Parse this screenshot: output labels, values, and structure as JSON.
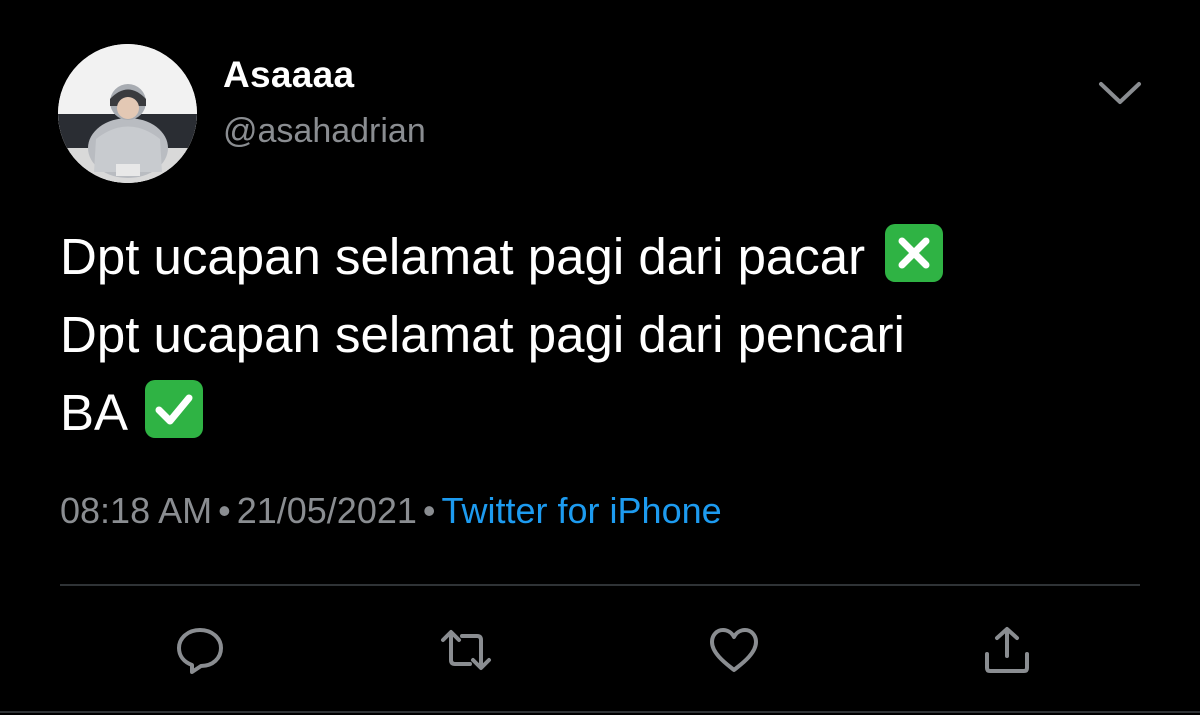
{
  "tweet": {
    "display_name": "Asaaaa",
    "handle": "@asahadrian",
    "lines": [
      "Dpt ucapan selamat pagi dari pacar",
      "Dpt ucapan selamat pagi dari pencari",
      "BA"
    ],
    "emoji_line1": "cross-mark-button",
    "emoji_line3": "check-mark-button",
    "time": "08:18 AM",
    "separator": "•",
    "date": "21/05/2021",
    "source": "Twitter for iPhone"
  },
  "icons": {
    "more": "chevron-down-icon",
    "reply": "reply-icon",
    "retweet": "retweet-icon",
    "like": "heart-icon",
    "share": "share-icon"
  },
  "colors": {
    "background": "#000000",
    "text": "#ffffff",
    "secondary": "#8a8d91",
    "link": "#1d9bf0",
    "emoji_green": "#2fb344",
    "divider": "#2f3336"
  }
}
